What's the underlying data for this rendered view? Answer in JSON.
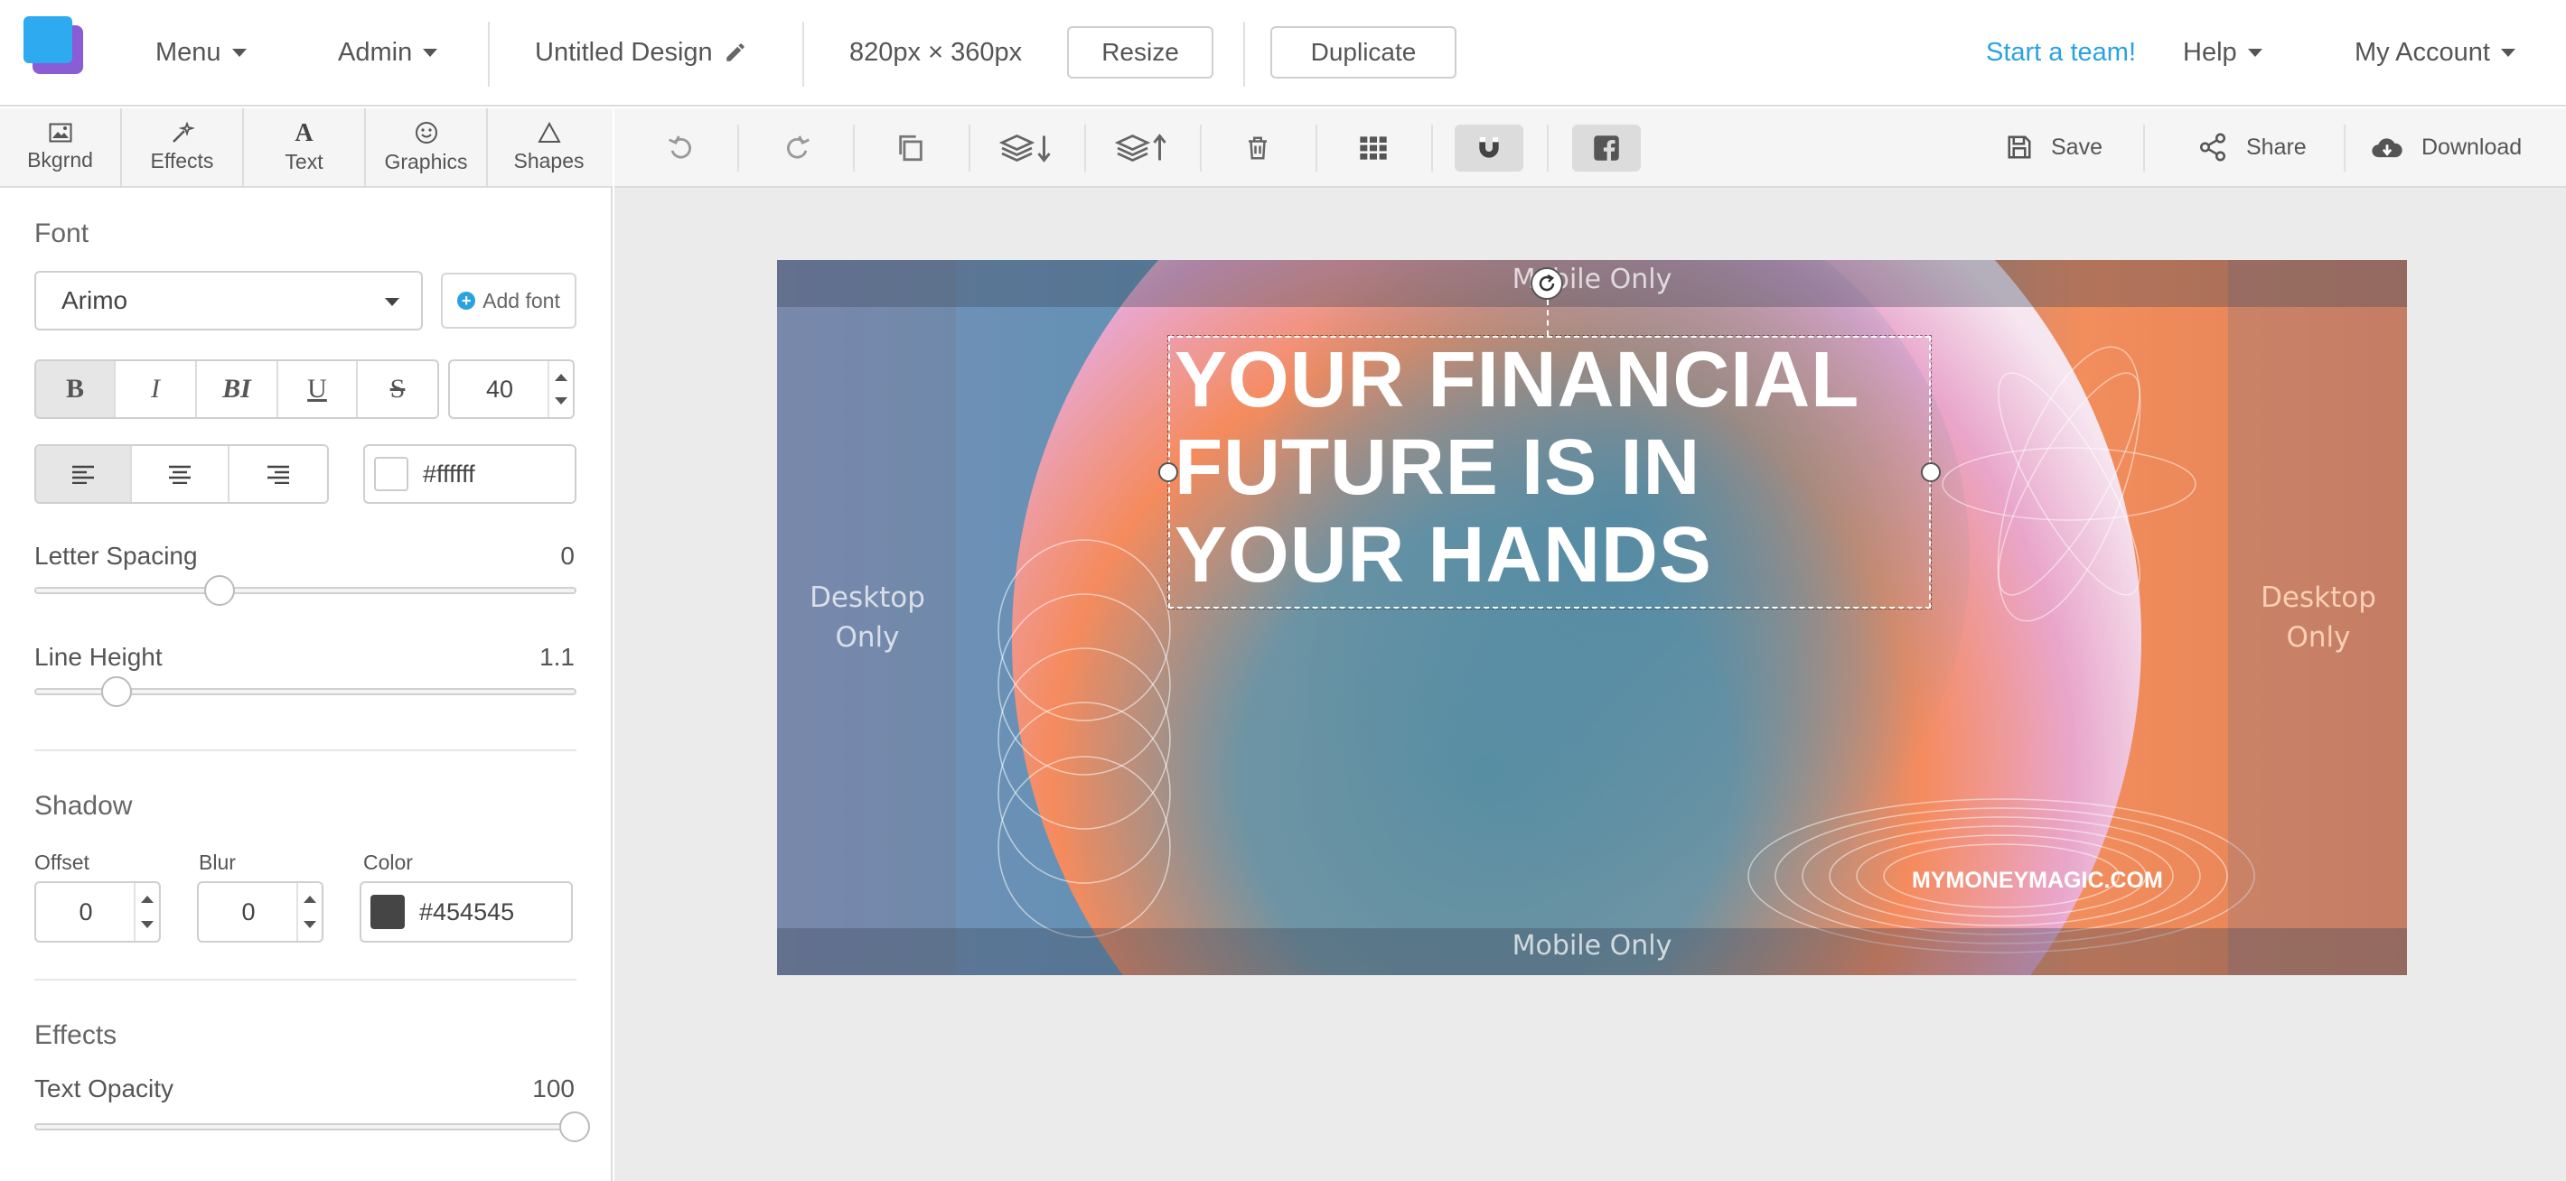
{
  "topbar": {
    "menu": "Menu",
    "admin": "Admin",
    "design_title": "Untitled Design",
    "dimensions": "820px × 360px",
    "resize": "Resize",
    "duplicate": "Duplicate",
    "start_team": "Start a team!",
    "help": "Help",
    "account": "My Account"
  },
  "tool_tabs": [
    {
      "label": "Bkgrnd",
      "icon": "image-icon"
    },
    {
      "label": "Effects",
      "icon": "magic-wand-icon"
    },
    {
      "label": "Text",
      "icon": "text-icon"
    },
    {
      "label": "Graphics",
      "icon": "smiley-icon"
    },
    {
      "label": "Shapes",
      "icon": "triangle-icon"
    }
  ],
  "toolbar": {
    "save": "Save",
    "share": "Share",
    "download": "Download",
    "icons": [
      "undo-icon",
      "redo-icon",
      "copy-icon",
      "layer-down-icon",
      "layer-up-icon",
      "trash-icon",
      "grid-icon",
      "magnet-icon",
      "facebook-icon"
    ]
  },
  "panel": {
    "font_heading": "Font",
    "font_name": "Arimo",
    "add_font": "Add font",
    "styles": [
      "B",
      "I",
      "BI",
      "U",
      "S"
    ],
    "font_size": "40",
    "text_color": "#ffffff",
    "letter_spacing_label": "Letter Spacing",
    "letter_spacing_value": "0",
    "letter_spacing_fraction": 0.34,
    "line_height_label": "Line Height",
    "line_height_value": "1.1",
    "line_height_fraction": 0.15,
    "shadow_heading": "Shadow",
    "offset_label": "Offset",
    "offset_value": "0",
    "blur_label": "Blur",
    "blur_value": "0",
    "color_label": "Color",
    "shadow_color": "#454545",
    "effects_heading": "Effects",
    "opacity_label": "Text Opacity",
    "opacity_value": "100",
    "opacity_fraction": 1.0
  },
  "canvas": {
    "mobile_only_top": "Mobile Only",
    "mobile_only_bottom": "Mobile Only",
    "desktop_only_left": "Desktop Only",
    "desktop_only_right": "Desktop Only",
    "headline": "YOUR FINANCIAL FUTURE IS IN YOUR HANDS",
    "brand": "MYMONEYMAGIC.COM"
  },
  "colors": {
    "accent": "#2ba2e0",
    "logo_front": "#2eaaf0",
    "logo_back": "#8a5cd6"
  }
}
